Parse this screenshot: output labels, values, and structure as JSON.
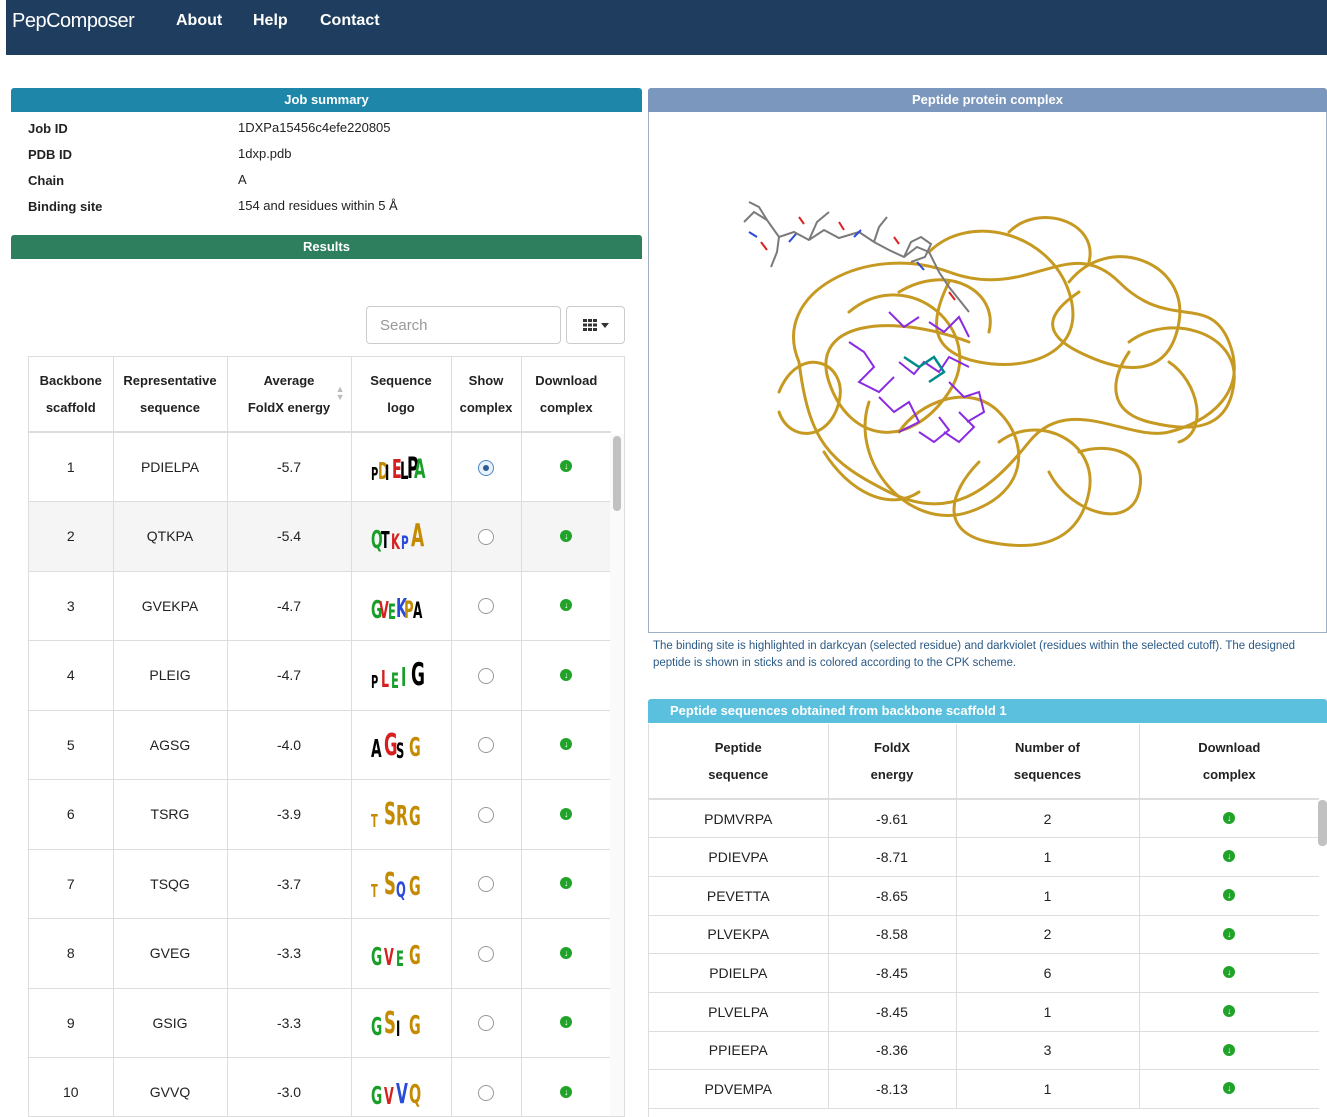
{
  "nav": {
    "brand": "PepComposer",
    "links": [
      "About",
      "Help",
      "Contact"
    ]
  },
  "job_summary": {
    "title": "Job summary",
    "rows": [
      {
        "label": "Job ID",
        "value": "1DXPa15456c4efe220805"
      },
      {
        "label": "PDB ID",
        "value": "1dxp.pdb"
      },
      {
        "label": "Chain",
        "value": "A"
      },
      {
        "label": "Binding site",
        "value": "154 and residues within 5 Å"
      }
    ]
  },
  "results": {
    "title": "Results",
    "search_placeholder": "Search",
    "columns_button_icon": "grid-icon",
    "headers": [
      [
        "Backbone",
        "scaffold"
      ],
      [
        "Representative",
        "sequence"
      ],
      [
        "Average",
        "FoldX energy"
      ],
      [
        "Sequence",
        "logo"
      ],
      [
        "Show",
        "complex"
      ],
      [
        "Download",
        "complex"
      ]
    ],
    "rows": [
      {
        "scaffold": "1",
        "sequence": "PDIELPA",
        "energy": "-5.7",
        "selected": true
      },
      {
        "scaffold": "2",
        "sequence": "QTKPA",
        "energy": "-5.4",
        "selected": false
      },
      {
        "scaffold": "3",
        "sequence": "GVEKPA",
        "energy": "-4.7",
        "selected": false
      },
      {
        "scaffold": "4",
        "sequence": "PLEIG",
        "energy": "-4.7",
        "selected": false
      },
      {
        "scaffold": "5",
        "sequence": "AGSG",
        "energy": "-4.0",
        "selected": false
      },
      {
        "scaffold": "6",
        "sequence": "TSRG",
        "energy": "-3.9",
        "selected": false
      },
      {
        "scaffold": "7",
        "sequence": "TSQG",
        "energy": "-3.7",
        "selected": false
      },
      {
        "scaffold": "8",
        "sequence": "GVEG",
        "energy": "-3.3",
        "selected": false
      },
      {
        "scaffold": "9",
        "sequence": "GSIG",
        "energy": "-3.3",
        "selected": false
      },
      {
        "scaffold": "10",
        "sequence": "GVVQ",
        "energy": "-3.0",
        "selected": false
      }
    ],
    "download_icon": "download-circle-icon",
    "colors": {
      "selected_radio": "#2d5d92",
      "download": "#21a32a",
      "alt_row": "#f5f5f5"
    }
  },
  "complex_viewer": {
    "title": "Peptide protein complex",
    "caption": "The binding site is highlighted in darkcyan (selected residue) and darkviolet (residues within the selected cutoff). The designed peptide is shown in sticks and is colored according to the CPK scheme.",
    "colors": {
      "ribbon": "#c69a22",
      "binding_site": "#8a2be2",
      "selected_residue": "#008b8b",
      "peptide": "#7a7a7a"
    }
  },
  "scaffold_sequences": {
    "title": "Peptide sequences obtained from backbone scaffold 1",
    "headers": [
      [
        "Peptide",
        "sequence"
      ],
      [
        "FoldX",
        "energy"
      ],
      [
        "Number of",
        "sequences"
      ],
      [
        "Download",
        "complex"
      ]
    ],
    "rows": [
      {
        "sequence": "PDMVRPA",
        "energy": "-9.61",
        "count": "2"
      },
      {
        "sequence": "PDIEVPA",
        "energy": "-8.71",
        "count": "1"
      },
      {
        "sequence": "PEVETTA",
        "energy": "-8.65",
        "count": "1"
      },
      {
        "sequence": "PLVEKPA",
        "energy": "-8.58",
        "count": "2"
      },
      {
        "sequence": "PDIELPA",
        "energy": "-8.45",
        "count": "6"
      },
      {
        "sequence": "PLVELPA",
        "energy": "-8.45",
        "count": "1"
      },
      {
        "sequence": "PPIEEPA",
        "energy": "-8.36",
        "count": "3"
      },
      {
        "sequence": "PDVEMPA",
        "energy": "-8.13",
        "count": "1"
      }
    ]
  },
  "theme": {
    "navbar": "#1f3e5f",
    "job_summary_header": "#1e86a8",
    "results_header": "#2e7f5e",
    "viewer_header": "#7b97bd",
    "sequences_header": "#5ac0de"
  }
}
